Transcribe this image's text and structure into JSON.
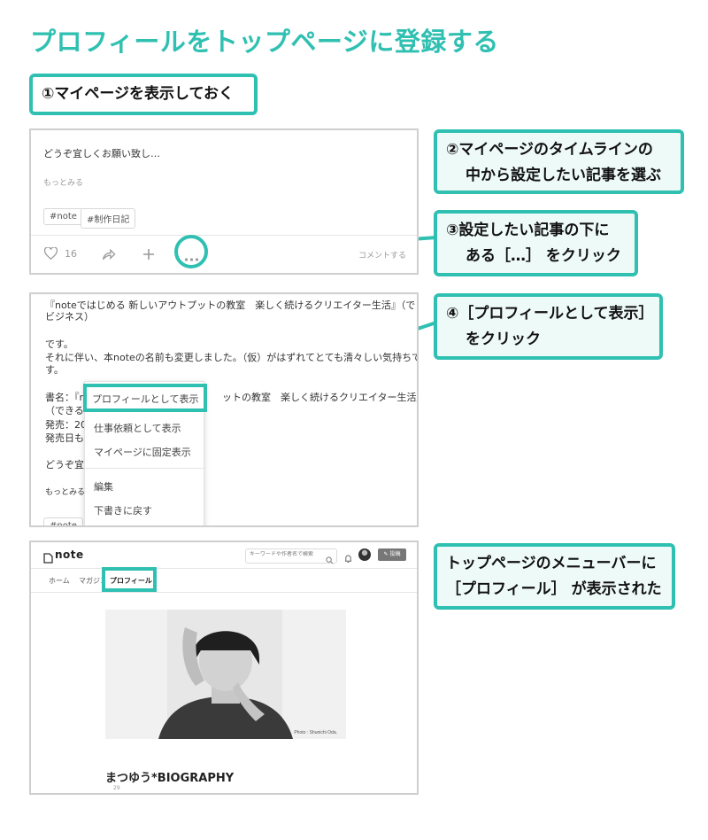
{
  "title": "プロフィールをトップページに登録する",
  "step1": "①マイページを表示しておく",
  "steps": {
    "s2_line1": "②マイページのタイムラインの",
    "s2_line2": "中から設定したい記事を選ぶ",
    "s3_line1": "③設定したい記事の下に",
    "s3_line2": "ある［…］ をクリック",
    "s4_line1": "④［プロフィールとして表示］",
    "s4_line2": "をクリック",
    "s5_line1": "トップページのメニューバーに",
    "s5_line2": "［プロフィール］ が表示された"
  },
  "shot1": {
    "body": "どうぞ宜しくお願い致し…",
    "more": "もっとみる",
    "tags": [
      "#note",
      "#制作日記"
    ],
    "like_count": "16",
    "comment": "コメントする"
  },
  "shot2": {
    "lines": [
      "『noteではじめる 新しいアウトプットの教室　楽しく続けるクリエイター生活』（できる",
      "ビジネス）",
      "",
      "です。",
      "それに伴い、本noteの名前も変更しました。（仮）がはずれてとても清々しい気持ちで",
      "す。",
      "",
      "書名：『n",
      "（できるビ",
      "発売：201",
      "発売日も解",
      "",
      "どうぞ宜し",
      "",
      "もっとみる"
    ],
    "behind_text": "ットの教室　楽しく続けるクリエイター生活』",
    "menu_items": [
      "プロフィールとして表示",
      "仕事依頼として表示",
      "マイページに固定表示",
      "編集",
      "下書きに戻す"
    ],
    "tag_partial": "#note"
  },
  "shot3": {
    "logo": "note",
    "search_placeholder": "キーワードや作者名で検索",
    "post_button": "投稿",
    "nav": [
      "ホーム",
      "マガジン",
      "プロフィール"
    ],
    "photo_credit": "Photo : Shunichi Oda.",
    "profile_title": "まつゆう*BIOGRAPHY",
    "likes": "29"
  },
  "colors": {
    "accent": "#2fc0b2",
    "callout_bg": "#eefaf8",
    "frame": "#cfcfcf"
  },
  "icons": [
    "heart-icon",
    "share-icon",
    "plus-icon",
    "more-dots-icon",
    "search-icon",
    "bell-icon",
    "pen-icon"
  ]
}
